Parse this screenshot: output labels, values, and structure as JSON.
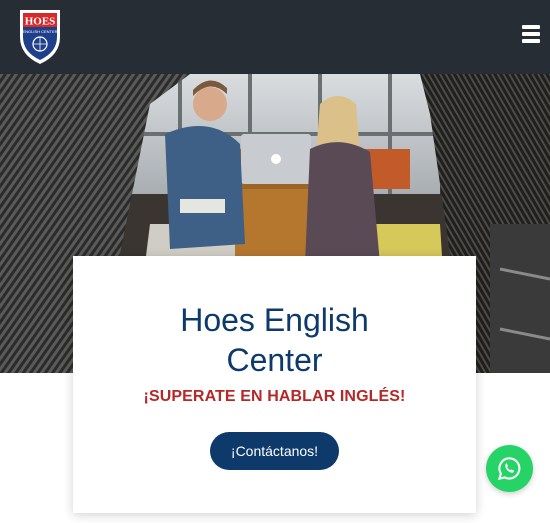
{
  "header": {
    "logo_text": "HOES",
    "logo_subtext": "ENGLISH CENTER",
    "menu_icon": "hamburger-menu-icon"
  },
  "hero": {
    "image": "two-people-meeting-with-laptop-photo"
  },
  "card": {
    "title_line1": "Hoes English",
    "title_line2": "Center",
    "subtitle": "¡SUPERATE EN HABLAR INGLÉS!",
    "cta_label": "¡Contáctanos!"
  },
  "floating": {
    "whatsapp_icon": "whatsapp-icon"
  },
  "colors": {
    "topbar": "#272d35",
    "brand_blue": "#0d3a6b",
    "accent_red": "#b52828",
    "whatsapp_green": "#25d366"
  }
}
